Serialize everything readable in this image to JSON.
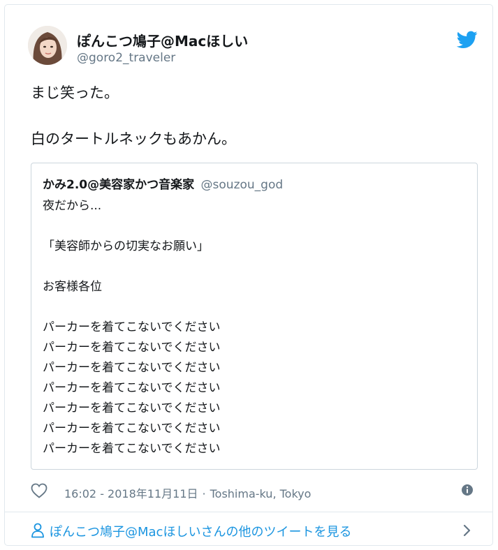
{
  "tweet": {
    "display_name": "ぽんこつ鳩子@Macほしい",
    "handle": "@goro2_traveler",
    "text_line1": "まじ笑った。",
    "text_line2": "白のタートルネックもあかん。"
  },
  "quoted_tweet": {
    "display_name": "かみ2.0@美容家かつ音楽家",
    "handle": "@souzou_god",
    "lines": [
      "夜だから...",
      "",
      "「美容師からの切実なお願い」",
      "",
      "お客様各位",
      "",
      "パーカーを着てこないでください",
      "パーカーを着てこないでください",
      "パーカーを着てこないでください",
      "パーカーを着てこないでください",
      "パーカーを着てこないでください",
      "パーカーを着てこないでください",
      "パーカーを着てこないでください"
    ]
  },
  "footer": {
    "timestamp": "16:02 - 2018年11月11日",
    "separator": "·",
    "location": "Toshima-ku, Tokyo"
  },
  "more_link": {
    "label": "ぽんこつ鳩子@Macほしいさんの他のツイートを見る"
  },
  "icons": {
    "avatar": "avatar",
    "brand": "twitter-bird-icon",
    "like": "heart-icon",
    "info": "info-icon",
    "person": "person-icon",
    "chevron": "chevron-right-icon"
  },
  "colors": {
    "brand_blue": "#1da1f2",
    "link_blue": "#1b95e0",
    "secondary_text": "#657786",
    "border": "#e1e8ed"
  }
}
